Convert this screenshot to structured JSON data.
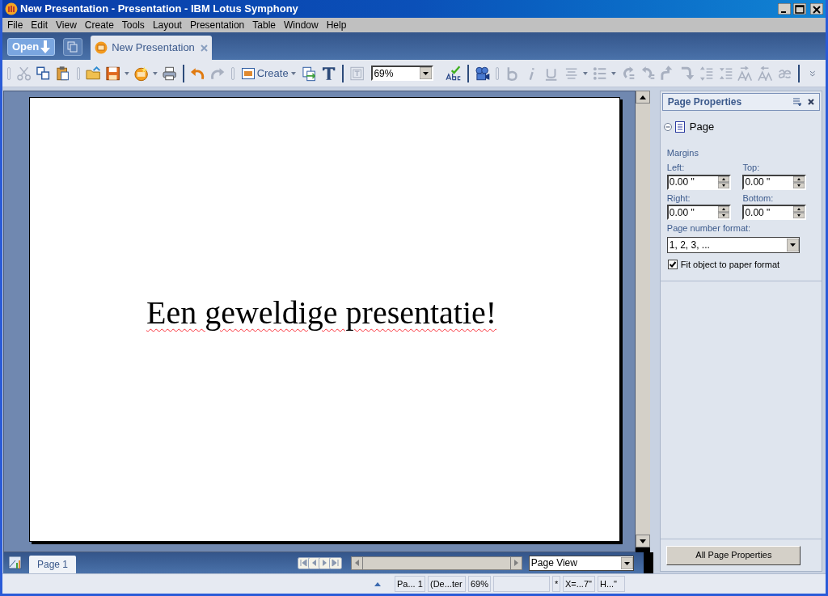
{
  "window": {
    "title": "New Presentation - Presentation - IBM Lotus Symphony"
  },
  "menu": [
    "File",
    "Edit",
    "View",
    "Create",
    "Tools",
    "Layout",
    "Presentation",
    "Table",
    "Window",
    "Help"
  ],
  "open_button": "Open",
  "tabs": [
    {
      "label": "New Presentation",
      "selected": true
    }
  ],
  "toolbar": {
    "create_button": "Create",
    "zoom_field": "69%"
  },
  "slide": {
    "text": "Een geweldige presentatie!",
    "spelling_error": true
  },
  "page_tabs": [
    {
      "label": "Page 1",
      "selected": true
    }
  ],
  "view_select": "Page View",
  "properties": {
    "title": "Page Properties",
    "section": {
      "label": "Page",
      "expanded": true
    },
    "margins_label": "Margins",
    "fields": [
      {
        "label": "Left:",
        "value": "0.00 \""
      },
      {
        "label": "Top:",
        "value": "0.00 \""
      },
      {
        "label": "Right:",
        "value": "0.00 \""
      },
      {
        "label": "Bottom:",
        "value": "0.00 \""
      }
    ],
    "format_label": "Page number format:",
    "format_value": "1, 2, 3, ...",
    "fit": {
      "label": "Fit object to paper format",
      "checked": true
    },
    "all_button": "All Page Properties"
  },
  "status_bar": [
    "Pa... 1",
    "(De...ter",
    "69%",
    "*",
    "X=...7\"",
    "H...\""
  ]
}
